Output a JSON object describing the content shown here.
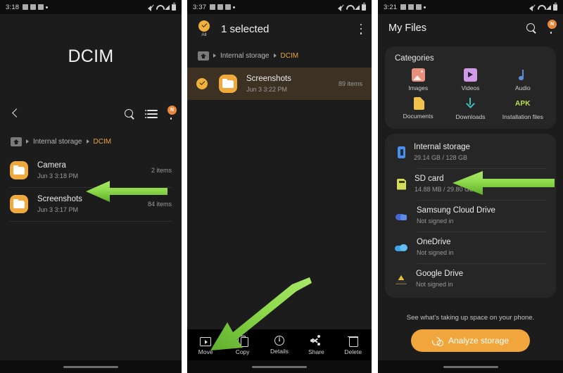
{
  "panels": {
    "left": {
      "statusbar": {
        "time": "3:18",
        "icons": [
          "folder-icon",
          "image-icon",
          "photo-icon",
          "dot-icon",
          "mute-icon",
          "wifi-icon",
          "signal-icon",
          "battery-icon"
        ]
      },
      "big_title": "DCIM",
      "actions": {
        "back": "back-chevron",
        "search": "Search",
        "view": "View as",
        "more": "More options",
        "badge": "N"
      },
      "breadcrumb": {
        "home": "Home",
        "segments": [
          "Internal storage",
          "DCIM"
        ],
        "current": "DCIM"
      },
      "files": [
        {
          "name": "Camera",
          "date": "Jun 3 3:18 PM",
          "count": "2 items"
        },
        {
          "name": "Screenshots",
          "date": "Jun 3 3:17 PM",
          "count": "84 items"
        }
      ]
    },
    "middle": {
      "statusbar": {
        "time": "3:37",
        "icons": [
          "photo-icon",
          "location-icon",
          "image-icon",
          "dot-icon",
          "mute-icon",
          "wifi-icon",
          "signal-icon",
          "battery-icon"
        ]
      },
      "select_all_label": "All",
      "title": "1 selected",
      "more_label": "More options",
      "breadcrumb": {
        "segments": [
          "Internal storage",
          "DCIM"
        ],
        "current": "DCIM"
      },
      "files": [
        {
          "name": "Screenshots",
          "date": "Jun 3 3:22 PM",
          "count": "89 items",
          "selected": true
        }
      ],
      "bottom_actions": [
        {
          "label": "Move",
          "icon": "move-icon"
        },
        {
          "label": "Copy",
          "icon": "copy-icon"
        },
        {
          "label": "Details",
          "icon": "details-icon"
        },
        {
          "label": "Share",
          "icon": "share-icon"
        },
        {
          "label": "Delete",
          "icon": "delete-icon"
        }
      ]
    },
    "right": {
      "statusbar": {
        "time": "3:21",
        "icons": [
          "folder-icon",
          "image-icon",
          "photo-icon",
          "dot-icon",
          "mute-icon",
          "wifi-icon",
          "signal-icon",
          "battery-icon"
        ]
      },
      "title": "My Files",
      "search_label": "Search",
      "more_label": "More options",
      "more_badge": "N",
      "categories_title": "Categories",
      "categories": [
        {
          "label": "Images",
          "icon": "images-icon"
        },
        {
          "label": "Videos",
          "icon": "videos-icon"
        },
        {
          "label": "Audio",
          "icon": "audio-icon"
        },
        {
          "label": "Documents",
          "icon": "documents-icon"
        },
        {
          "label": "Downloads",
          "icon": "downloads-icon"
        },
        {
          "label": "Installation files",
          "icon": "apk-icon"
        }
      ],
      "apk_text": "APK",
      "storage": [
        {
          "name": "Internal storage",
          "sub": "29.14 GB / 128 GB",
          "icon": "internal-storage-icon"
        },
        {
          "name": "SD card",
          "sub": "14.88 MB / 29.80 GB",
          "icon": "sd-card-icon"
        },
        {
          "name": "Samsung Cloud Drive",
          "sub": "Not signed in",
          "icon": "samsung-cloud-icon"
        },
        {
          "name": "OneDrive",
          "sub": "Not signed in",
          "icon": "onedrive-icon"
        },
        {
          "name": "Google Drive",
          "sub": "Not signed in",
          "icon": "google-drive-icon"
        }
      ],
      "analyze_note": "See what's taking up space on your phone.",
      "analyze_button": "Analyze storage"
    }
  },
  "colors": {
    "accent_orange": "#efa93c",
    "arrow_green": "#7ed143",
    "selected_row": "#3c3122",
    "card_bg": "#262626",
    "phone_bg": "#1c1c1c"
  },
  "annotations": [
    {
      "name": "arrow-to-camera-folder",
      "color": "#7ed143"
    },
    {
      "name": "arrow-to-move-button",
      "color": "#7ed143"
    },
    {
      "name": "arrow-to-sd-card",
      "color": "#7ed143"
    }
  ]
}
